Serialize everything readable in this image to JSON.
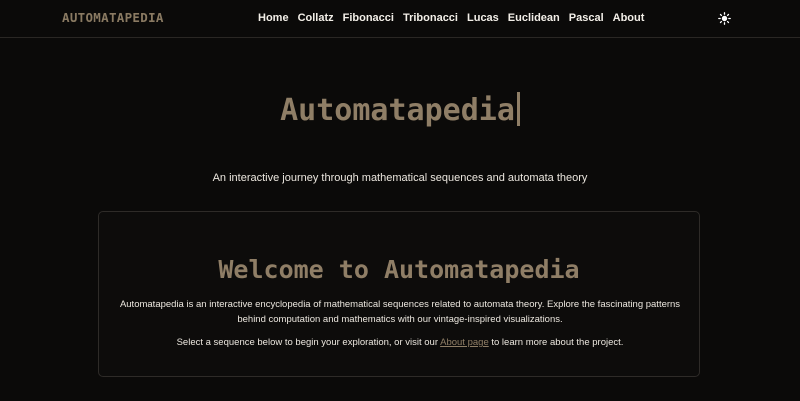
{
  "nav": {
    "brand": "AUTOMATAPEDIA",
    "links": [
      "Home",
      "Collatz",
      "Fibonacci",
      "Tribonacci",
      "Lucas",
      "Euclidean",
      "Pascal",
      "About"
    ],
    "theme_icon": "sun-icon"
  },
  "hero": {
    "title": "Automatapedia",
    "subtitle": "An interactive journey through mathematical sequences and automata theory"
  },
  "welcome": {
    "heading": "Welcome to Automatapedia",
    "paragraph1": "Automatapedia is an interactive encyclopedia of mathematical sequences related to automata theory. Explore the fascinating patterns behind computation and mathematics with our vintage-inspired visualizations.",
    "paragraph2_before": "Select a sequence below to begin your exploration, or visit our ",
    "paragraph2_link": "About page",
    "paragraph2_after": " to learn more about the project."
  },
  "colors": {
    "background": "#0b0a09",
    "accent": "#8f7e66",
    "text": "#ece7df"
  }
}
